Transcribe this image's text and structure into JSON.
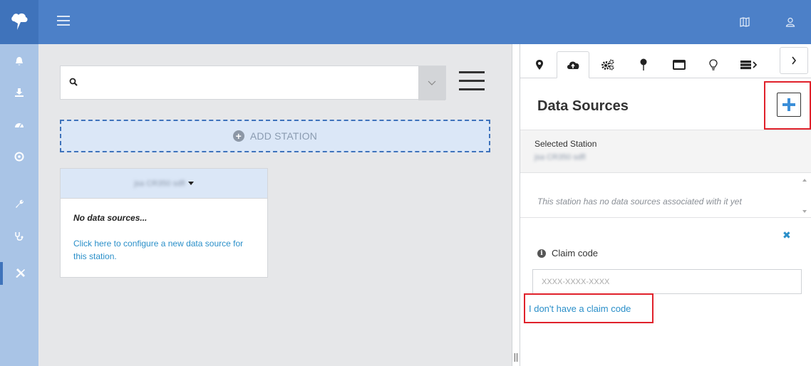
{
  "topbar": {
    "logo_icon": "cloud-lightning-icon",
    "menu_icon": "hamburger-icon",
    "map_icon": "map-icon",
    "user_icon": "user-icon",
    "bg_color": "#4c80c8"
  },
  "sidebar": {
    "items": [
      {
        "icon": "bell-icon"
      },
      {
        "icon": "download-icon"
      },
      {
        "icon": "dashboard-icon"
      },
      {
        "icon": "target-icon"
      },
      {
        "icon": "wrench-icon"
      },
      {
        "icon": "stethoscope-icon"
      },
      {
        "icon": "tools-icon",
        "active": true
      }
    ]
  },
  "main": {
    "search": {
      "value": "",
      "placeholder": ""
    },
    "add_station_label": "ADD STATION",
    "station_card": {
      "name": "jsa CR350 sdfl",
      "no_sources": "No data sources...",
      "config_link": "Click here to configure a new data source for this station."
    }
  },
  "panel": {
    "tabs": [
      {
        "icon": "location-pin-icon"
      },
      {
        "icon": "cloud-upload-icon",
        "active": true
      },
      {
        "icon": "cogs-icon"
      },
      {
        "icon": "pushpin-icon"
      },
      {
        "icon": "window-icon"
      },
      {
        "icon": "lightbulb-icon"
      },
      {
        "icon": "server-icon"
      }
    ],
    "title": "Data Sources",
    "add_button_icon": "plus-icon",
    "selected_station_label": "Selected Station",
    "selected_station_value": "jsa CR350 sdfl",
    "empty_message": "This station has no data sources associated with it yet",
    "claim_code_label": "Claim code",
    "claim_code_placeholder": "XXXX-XXXX-XXXX",
    "no_claim_link": "I don't have a claim code"
  },
  "colors": {
    "accent": "#4c80c8",
    "link": "#2a8fc9",
    "highlight": "#e0212b"
  }
}
